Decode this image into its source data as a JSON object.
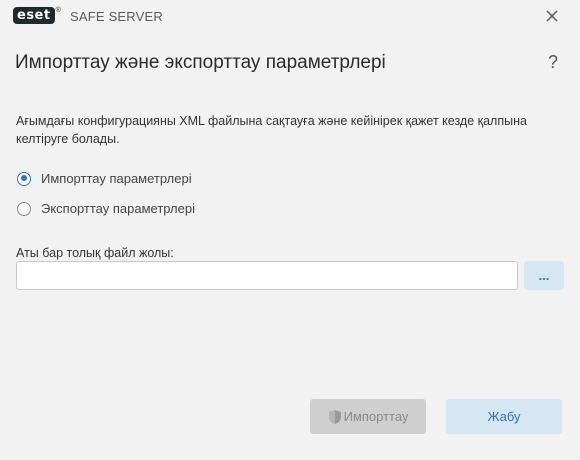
{
  "titlebar": {
    "logo_text": "eset",
    "logo_reg": "®",
    "product": "SAFE SERVER"
  },
  "header": {
    "title": "Импорттау және экспорттау параметрлері",
    "help": "?"
  },
  "description": "Ағымдағы конфигурацияны XML файлына сақтауға және кейінірек қажет кезде қалпына келтіруге болады.",
  "options": [
    {
      "label": "Импорттау параметрлері",
      "selected": true
    },
    {
      "label": "Экспорттау параметрлері",
      "selected": false
    }
  ],
  "file_path": {
    "label": "Аты бар толық файл жолы:",
    "value": "",
    "browse_label": "..."
  },
  "buttons": {
    "import_label": "Импорттау",
    "import_icon": "shield-icon",
    "close_label": "Жабу"
  },
  "colors": {
    "accent": "#2f73b5",
    "secondary_button_bg": "#d6e6f3",
    "disabled_button_bg": "#cfcfd0",
    "background": "#f2f2f3"
  }
}
